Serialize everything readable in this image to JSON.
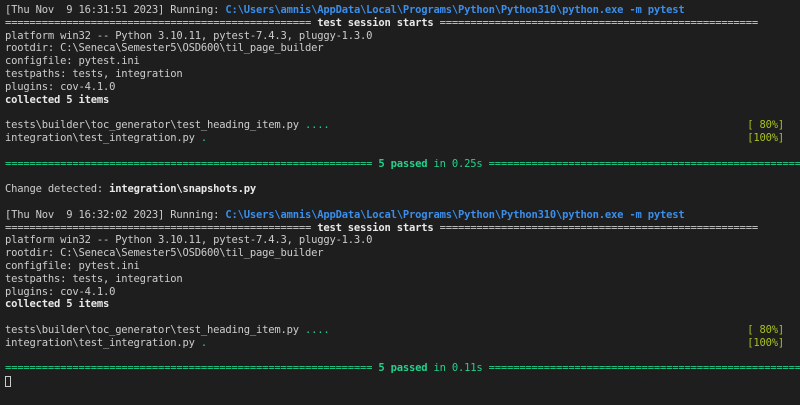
{
  "runs": [
    {
      "header_prefix": "[Thu Nov  9 16:31:51 2023] Running: ",
      "command": "C:\\Users\\amnis\\AppData\\Local\\Programs\\Python\\Python310\\python.exe -m pytest",
      "session_left": "================================================== ",
      "session_title": "test session starts",
      "session_right": " ====================================================",
      "platform": "platform win32 -- Python 3.10.11, pytest-7.4.3, pluggy-1.3.0",
      "rootdir": "rootdir: C:\\Seneca\\Semester5\\OSD600\\til_page_builder",
      "configfile": "configfile: pytest.ini",
      "testpaths": "testpaths: tests, integration",
      "plugins": "plugins: cov-4.1.0",
      "collected": "collected 5 items",
      "test_files": [
        {
          "path": "tests\\builder\\toc_generator\\test_heading_item.py ",
          "dots": "....",
          "percent": "[ 80%]"
        },
        {
          "path": "integration\\test_integration.py ",
          "dots": ".",
          "percent": "[100%]"
        }
      ],
      "result_left": "============================================================ ",
      "result_passed": "5 passed",
      "result_time": " in 0.25s ",
      "result_right": "============================================================="
    },
    {
      "header_prefix": "[Thu Nov  9 16:32:02 2023] Running: ",
      "command": "C:\\Users\\amnis\\AppData\\Local\\Programs\\Python\\Python310\\python.exe -m pytest",
      "session_left": "================================================== ",
      "session_title": "test session starts",
      "session_right": " ====================================================",
      "platform": "platform win32 -- Python 3.10.11, pytest-7.4.3, pluggy-1.3.0",
      "rootdir": "rootdir: C:\\Seneca\\Semester5\\OSD600\\til_page_builder",
      "configfile": "configfile: pytest.ini",
      "testpaths": "testpaths: tests, integration",
      "plugins": "plugins: cov-4.1.0",
      "collected": "collected 5 items",
      "test_files": [
        {
          "path": "tests\\builder\\toc_generator\\test_heading_item.py ",
          "dots": "....",
          "percent": "[ 80%]"
        },
        {
          "path": "integration\\test_integration.py ",
          "dots": ".",
          "percent": "[100%]"
        }
      ],
      "result_left": "============================================================ ",
      "result_passed": "5 passed",
      "result_time": " in 0.11s ",
      "result_right": "============================================================="
    }
  ],
  "change_detected": {
    "label": "Change detected: ",
    "file": "integration\\snapshots.py"
  },
  "colors": {
    "background": "#1e1e1e",
    "text": "#cccccc",
    "command": "#3b8eea",
    "passed": "#23d18b",
    "percent": "#a8c023"
  }
}
